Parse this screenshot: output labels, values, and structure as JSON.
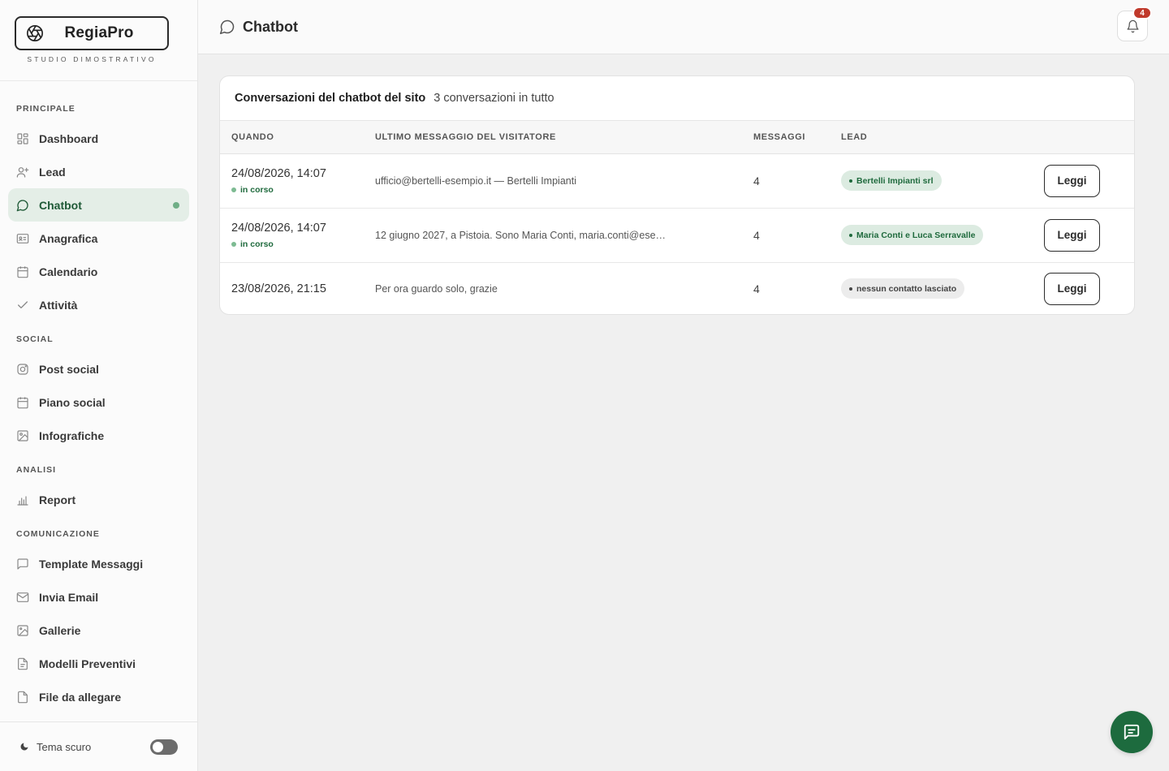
{
  "brand": {
    "name": "RegiaPro",
    "subtitle": "STUDIO DIMOSTRATIVO"
  },
  "sidebar": {
    "sections": [
      {
        "title": "PRINCIPALE",
        "items": [
          {
            "label": "Dashboard",
            "icon": "grid-icon"
          },
          {
            "label": "Lead",
            "icon": "user-plus-icon"
          },
          {
            "label": "Chatbot",
            "icon": "chat-bubble-icon",
            "active": true
          },
          {
            "label": "Anagrafica",
            "icon": "id-card-icon"
          },
          {
            "label": "Calendario",
            "icon": "calendar-icon"
          },
          {
            "label": "Attività",
            "icon": "check-icon"
          }
        ]
      },
      {
        "title": "SOCIAL",
        "items": [
          {
            "label": "Post social",
            "icon": "instagram-icon"
          },
          {
            "label": "Piano social",
            "icon": "calendar-grid-icon"
          },
          {
            "label": "Infografiche",
            "icon": "image-icon"
          }
        ]
      },
      {
        "title": "ANALISI",
        "items": [
          {
            "label": "Report",
            "icon": "bar-chart-icon"
          }
        ]
      },
      {
        "title": "COMUNICAZIONE",
        "items": [
          {
            "label": "Template Messaggi",
            "icon": "message-square-icon"
          },
          {
            "label": "Invia Email",
            "icon": "mail-icon"
          },
          {
            "label": "Gallerie",
            "icon": "gallery-icon"
          },
          {
            "label": "Modelli Preventivi",
            "icon": "document-icon"
          },
          {
            "label": "File da allegare",
            "icon": "file-icon"
          }
        ]
      }
    ],
    "footer": {
      "label": "Tema scuro",
      "toggle_on": false
    }
  },
  "header": {
    "title": "Chatbot",
    "notification_count": "4"
  },
  "card": {
    "title": "Conversazioni del chatbot del sito",
    "count_text": "3 conversazioni in tutto",
    "columns": [
      "QUANDO",
      "ULTIMO MESSAGGIO DEL VISITATORE",
      "MESSAGGI",
      "LEAD",
      ""
    ],
    "rows": [
      {
        "when": "24/08/2026, 14:07",
        "status": "in corso",
        "message": "ufficio@bertelli-esempio.it — Bertelli Impianti",
        "count": "4",
        "lead": "Bertelli Impianti srl",
        "lead_type": "green",
        "action": "Leggi"
      },
      {
        "when": "24/08/2026, 14:07",
        "status": "in corso",
        "message": "12 giugno 2027, a Pistoia. Sono Maria Conti, maria.conti@ese…",
        "count": "4",
        "lead": "Maria Conti e Luca Serravalle",
        "lead_type": "green",
        "action": "Leggi"
      },
      {
        "when": "23/08/2026, 21:15",
        "status": "",
        "message": "Per ora guardo solo, grazie",
        "count": "4",
        "lead": "nessun contatto lasciato",
        "lead_type": "gray",
        "action": "Leggi"
      }
    ]
  },
  "colors": {
    "accent": "#1d6b3e",
    "active_bg": "#e4eee7",
    "badge": "#c0392b"
  }
}
